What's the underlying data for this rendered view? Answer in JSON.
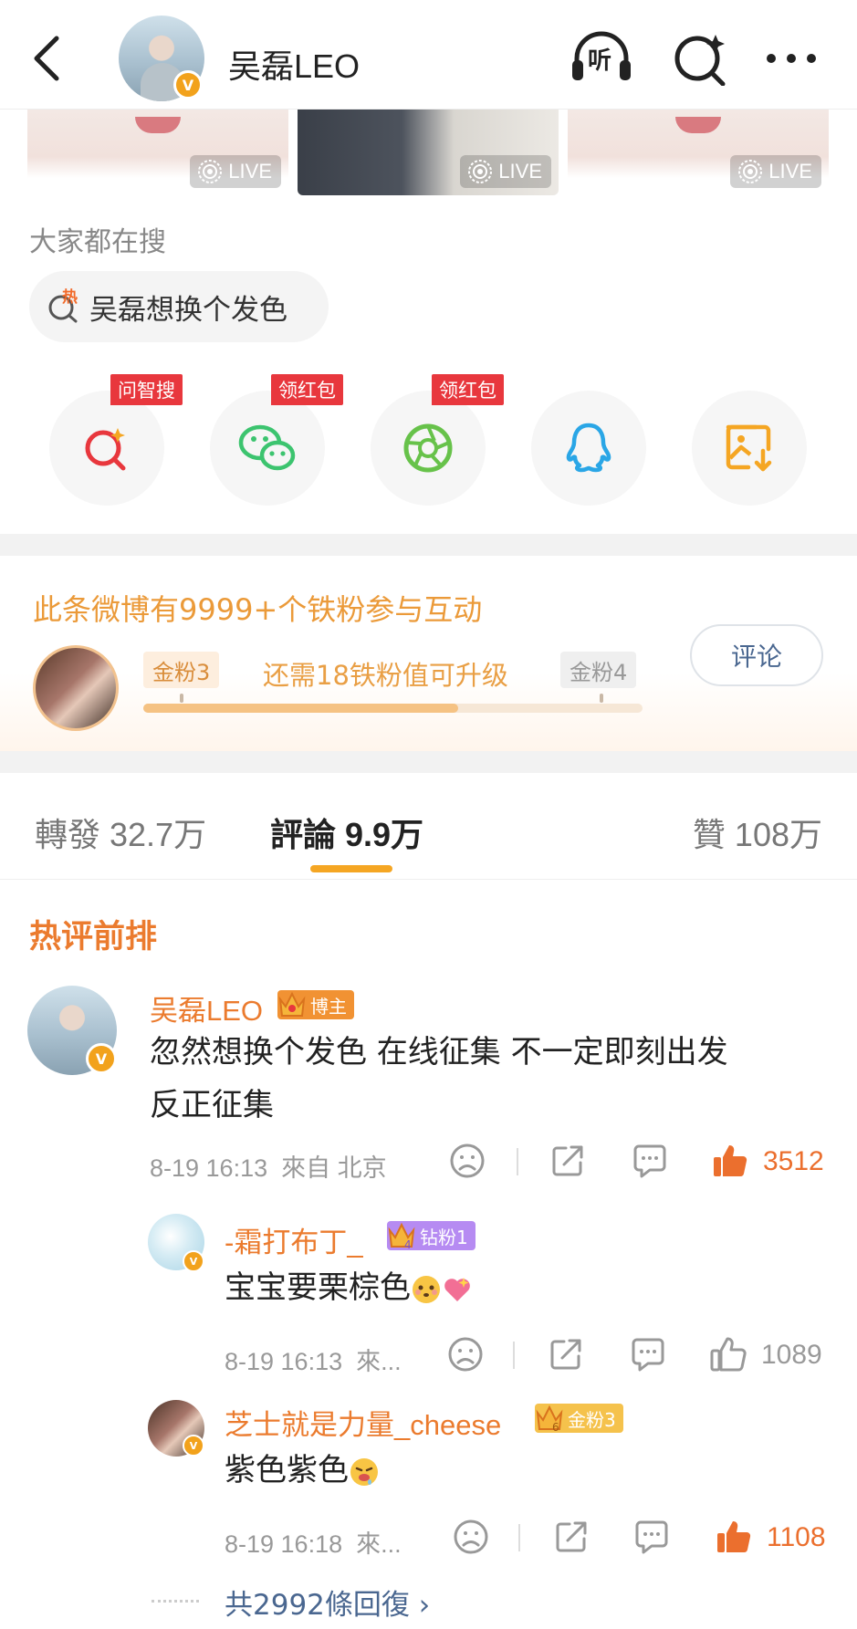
{
  "header": {
    "back_icon": "back-arrow-icon",
    "user_name": "吴磊LEO",
    "verified_badge": "V",
    "icons": [
      "listen-icon",
      "search-spark-icon",
      "more-icon"
    ],
    "listen_label": "听"
  },
  "live_thumbs": [
    {
      "label": "LIVE"
    },
    {
      "label": "LIVE"
    },
    {
      "label": "LIVE"
    }
  ],
  "search": {
    "title": "大家都在搜",
    "hot_tag": "热",
    "hot_query": "吴磊想换个发色"
  },
  "share": [
    {
      "icon": "ai-search-icon",
      "tag": "问智搜",
      "color": "#e8373d"
    },
    {
      "icon": "wechat-icon",
      "tag": "领红包",
      "color": "#3cc46f"
    },
    {
      "icon": "moments-icon",
      "tag": "领红包",
      "color": "#67c24a"
    },
    {
      "icon": "qq-icon",
      "tag": "",
      "color": "#2aa6e6"
    },
    {
      "icon": "save-image-icon",
      "tag": "",
      "color": "#f5a623"
    }
  ],
  "fans": {
    "title": "此条微博有9999+个铁粉参与互动",
    "current_level": "金粉3",
    "need_text": "还需18铁粉值可升级",
    "next_level": "金粉4",
    "progress": 0.63,
    "comment_button": "评论"
  },
  "tabs": {
    "repost": "轉發 32.7万",
    "comment": "評論 9.9万",
    "like": "贊 108万"
  },
  "hot_heading": "热评前排",
  "comments": [
    {
      "name": "吴磊LEO",
      "badge": "博主",
      "crown_level": "",
      "text_line1": "忽然想换个发色 在线征集 不一定即刻出发",
      "text_line2": "反正征集",
      "time": "8-19 16:13",
      "location": "來自 北京",
      "likes": "3512",
      "liked": true
    },
    {
      "name": "-霜打布丁_",
      "badge": "钻粉1",
      "crown_level": "4",
      "text": "宝宝要栗棕色",
      "time": "8-19 16:13",
      "location": "來...",
      "likes": "1089",
      "liked": false
    },
    {
      "name": "芝士就是力量_cheese",
      "badge": "金粉3",
      "crown_level": "6",
      "text": "紫色紫色",
      "time": "8-19 16:18",
      "location": "來...",
      "likes": "1108",
      "liked": true
    }
  ],
  "replies": "共2992條回復 ›",
  "colors": {
    "accent_orange": "#eb7b2e",
    "like_orange": "#eb6f2e",
    "fans_gold": "#eb9a39",
    "link_blue": "#4a6790",
    "tab_underline": "#f5a623"
  }
}
